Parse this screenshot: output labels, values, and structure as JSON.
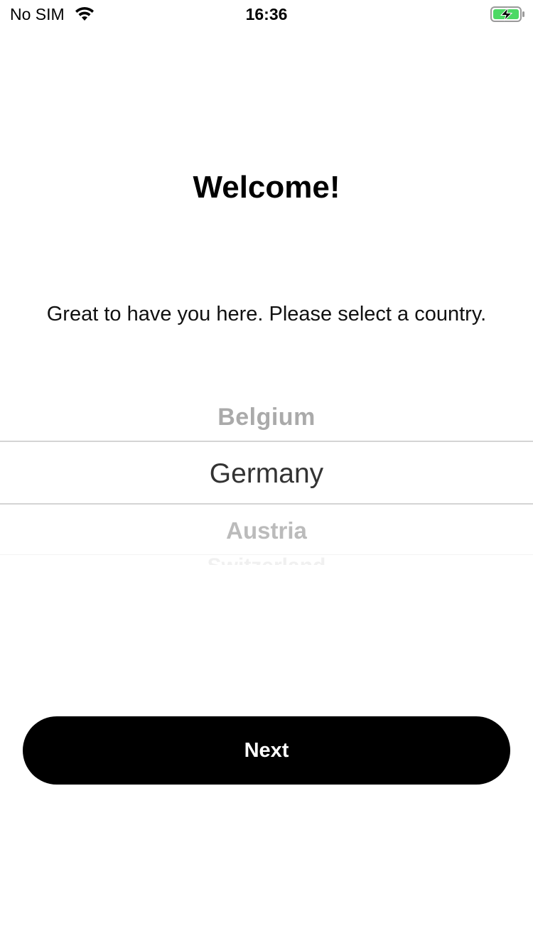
{
  "status_bar": {
    "carrier": "No SIM",
    "time": "16:36",
    "wifi_icon": "wifi-icon",
    "battery_icon": "battery-charging-icon",
    "battery_color": "#4cd964"
  },
  "welcome": {
    "title": "Welcome!",
    "subtitle": "Great to have you here. Please select a country."
  },
  "country_picker": {
    "items": [
      "Belgium",
      "Germany",
      "Austria",
      "Switzerland"
    ],
    "selected": "Germany"
  },
  "actions": {
    "next_label": "Next"
  }
}
